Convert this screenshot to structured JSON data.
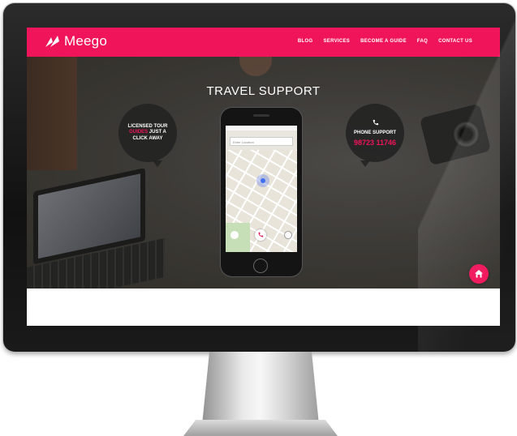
{
  "navbar": {
    "logo_text": "Meego",
    "links": [
      "BLOG",
      "SERVICES",
      "BECOME A GUIDE",
      "FAQ",
      "CONTACT US"
    ]
  },
  "hero": {
    "title": "TRAVEL SUPPORT",
    "left_bubble": {
      "line1": "LICENSED TOUR",
      "highlight": "GUIDES",
      "line2_rest": " JUST A",
      "line3": "CLICK AWAY"
    },
    "right_bubble": {
      "label": "PHONE SUPPORT",
      "number": "98723 11746"
    },
    "phone_app": {
      "search_placeholder": "Enter Location"
    }
  },
  "colors": {
    "brand": "#f0145a",
    "bubble": "#222222"
  },
  "icons": [
    "logo-icon",
    "phone-icon",
    "call-icon",
    "home-icon"
  ]
}
